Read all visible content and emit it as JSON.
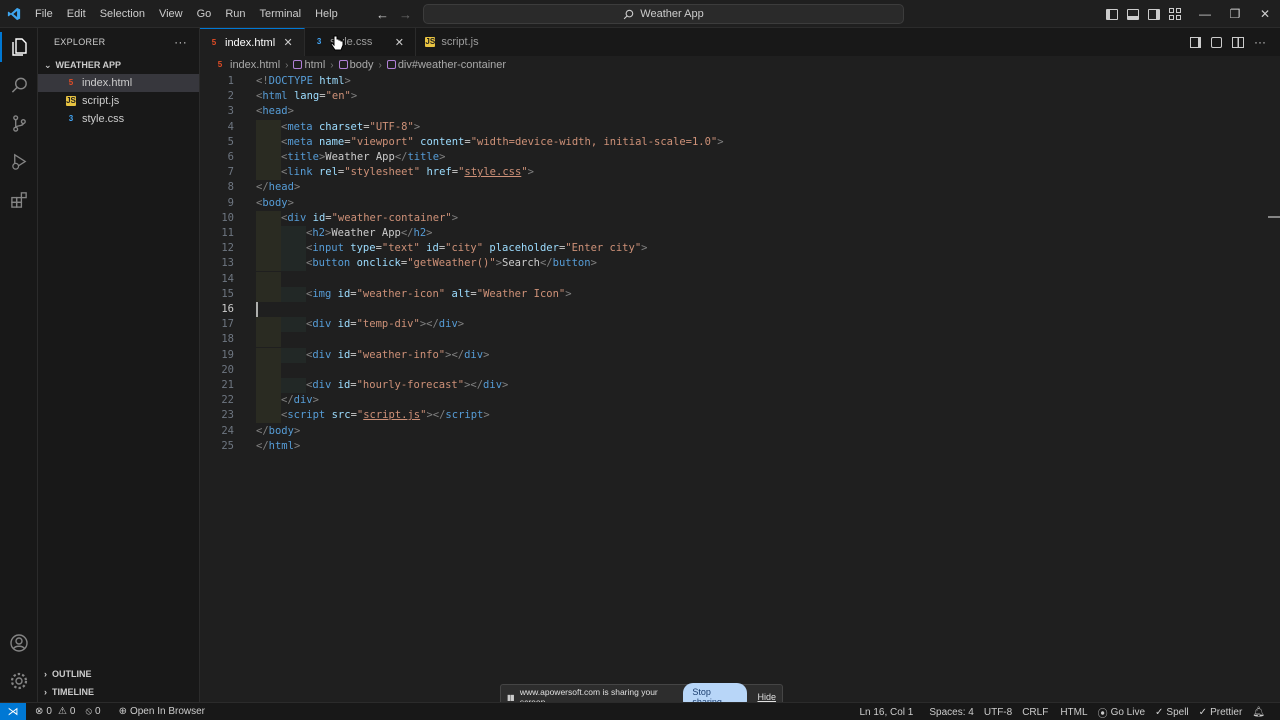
{
  "titlebar": {
    "menus": [
      "File",
      "Edit",
      "Selection",
      "View",
      "Go",
      "Run",
      "Terminal",
      "Help"
    ],
    "search_text": "Weather App",
    "controls": {
      "minimize": "—",
      "maximize": "❐",
      "close": "✕"
    }
  },
  "sidebar": {
    "header": "EXPLORER",
    "more": "···",
    "folder": "WEATHER APP",
    "files": [
      {
        "name": "index.html",
        "type": "html",
        "selected": true
      },
      {
        "name": "script.js",
        "type": "js",
        "selected": false
      },
      {
        "name": "style.css",
        "type": "css",
        "selected": false
      }
    ],
    "outline": "OUTLINE",
    "timeline": "TIMELINE"
  },
  "tabs": [
    {
      "label": "index.html",
      "type": "html",
      "active": true
    },
    {
      "label": "style.css",
      "type": "css",
      "active": false
    },
    {
      "label": "script.js",
      "type": "js",
      "active": false
    }
  ],
  "breadcrumb": {
    "file": "index.html",
    "items": [
      "html",
      "body",
      "div#weather-container"
    ]
  },
  "editor": {
    "current_line": 16,
    "lines": [
      {
        "n": "1",
        "tokens": [
          [
            "c-bracket",
            "<!"
          ],
          [
            "c-tag",
            "DOCTYPE"
          ],
          [
            "c-text",
            " "
          ],
          [
            "c-attr",
            "html"
          ],
          [
            "c-bracket",
            ">"
          ]
        ]
      },
      {
        "n": "2",
        "tokens": [
          [
            "c-bracket",
            "<"
          ],
          [
            "c-tag",
            "html"
          ],
          [
            "c-text",
            " "
          ],
          [
            "c-attr",
            "lang"
          ],
          [
            "c-text",
            "="
          ],
          [
            "c-str",
            "\"en\""
          ],
          [
            "c-bracket",
            ">"
          ]
        ]
      },
      {
        "n": "3",
        "tokens": [
          [
            "c-bracket",
            "<"
          ],
          [
            "c-tag",
            "head"
          ],
          [
            "c-bracket",
            ">"
          ]
        ]
      },
      {
        "n": "4",
        "indent": 1,
        "tokens": [
          [
            "c-bracket",
            "<"
          ],
          [
            "c-tag",
            "meta"
          ],
          [
            "c-text",
            " "
          ],
          [
            "c-attr",
            "charset"
          ],
          [
            "c-text",
            "="
          ],
          [
            "c-str",
            "\"UTF-8\""
          ],
          [
            "c-bracket",
            ">"
          ]
        ]
      },
      {
        "n": "5",
        "indent": 1,
        "tokens": [
          [
            "c-bracket",
            "<"
          ],
          [
            "c-tag",
            "meta"
          ],
          [
            "c-text",
            " "
          ],
          [
            "c-attr",
            "name"
          ],
          [
            "c-text",
            "="
          ],
          [
            "c-str",
            "\"viewport\""
          ],
          [
            "c-text",
            " "
          ],
          [
            "c-attr",
            "content"
          ],
          [
            "c-text",
            "="
          ],
          [
            "c-str",
            "\"width=device-width, initial-scale=1.0\""
          ],
          [
            "c-bracket",
            ">"
          ]
        ]
      },
      {
        "n": "6",
        "indent": 1,
        "tokens": [
          [
            "c-bracket",
            "<"
          ],
          [
            "c-tag",
            "title"
          ],
          [
            "c-bracket",
            ">"
          ],
          [
            "c-text",
            "Weather App"
          ],
          [
            "c-bracket",
            "</"
          ],
          [
            "c-tag",
            "title"
          ],
          [
            "c-bracket",
            ">"
          ]
        ]
      },
      {
        "n": "7",
        "indent": 1,
        "tokens": [
          [
            "c-bracket",
            "<"
          ],
          [
            "c-tag",
            "link"
          ],
          [
            "c-text",
            " "
          ],
          [
            "c-attr",
            "rel"
          ],
          [
            "c-text",
            "="
          ],
          [
            "c-str",
            "\"stylesheet\""
          ],
          [
            "c-text",
            " "
          ],
          [
            "c-attr",
            "href"
          ],
          [
            "c-text",
            "="
          ],
          [
            "c-str",
            "\""
          ],
          [
            "c-str c-ul",
            "style.css"
          ],
          [
            "c-str",
            "\""
          ],
          [
            "c-bracket",
            ">"
          ]
        ]
      },
      {
        "n": "8",
        "tokens": [
          [
            "c-bracket",
            "</"
          ],
          [
            "c-tag",
            "head"
          ],
          [
            "c-bracket",
            ">"
          ]
        ]
      },
      {
        "n": "9",
        "tokens": [
          [
            "c-bracket",
            "<"
          ],
          [
            "c-tag",
            "body"
          ],
          [
            "c-bracket",
            ">"
          ]
        ]
      },
      {
        "n": "10",
        "indent": 1,
        "tokens": [
          [
            "c-bracket",
            "<"
          ],
          [
            "c-tag",
            "div"
          ],
          [
            "c-text",
            " "
          ],
          [
            "c-attr",
            "id"
          ],
          [
            "c-text",
            "="
          ],
          [
            "c-str",
            "\"weather-container\""
          ],
          [
            "c-bracket",
            ">"
          ]
        ]
      },
      {
        "n": "11",
        "indent": 2,
        "tokens": [
          [
            "c-bracket",
            "<"
          ],
          [
            "c-tag",
            "h2"
          ],
          [
            "c-bracket",
            ">"
          ],
          [
            "c-text",
            "Weather App"
          ],
          [
            "c-bracket",
            "</"
          ],
          [
            "c-tag",
            "h2"
          ],
          [
            "c-bracket",
            ">"
          ]
        ]
      },
      {
        "n": "12",
        "indent": 2,
        "tokens": [
          [
            "c-bracket",
            "<"
          ],
          [
            "c-tag",
            "input"
          ],
          [
            "c-text",
            " "
          ],
          [
            "c-attr",
            "type"
          ],
          [
            "c-text",
            "="
          ],
          [
            "c-str",
            "\"text\""
          ],
          [
            "c-text",
            " "
          ],
          [
            "c-attr",
            "id"
          ],
          [
            "c-text",
            "="
          ],
          [
            "c-str",
            "\"city\""
          ],
          [
            "c-text",
            " "
          ],
          [
            "c-attr",
            "placeholder"
          ],
          [
            "c-text",
            "="
          ],
          [
            "c-str",
            "\"Enter city\""
          ],
          [
            "c-bracket",
            ">"
          ]
        ]
      },
      {
        "n": "13",
        "indent": 2,
        "tokens": [
          [
            "c-bracket",
            "<"
          ],
          [
            "c-tag",
            "button"
          ],
          [
            "c-text",
            " "
          ],
          [
            "c-attr",
            "onclick"
          ],
          [
            "c-text",
            "="
          ],
          [
            "c-str",
            "\"getWeather()\""
          ],
          [
            "c-bracket",
            ">"
          ],
          [
            "c-text",
            "Search"
          ],
          [
            "c-bracket",
            "</"
          ],
          [
            "c-tag",
            "button"
          ],
          [
            "c-bracket",
            ">"
          ]
        ]
      },
      {
        "n": "14",
        "indent": 1,
        "tokens": []
      },
      {
        "n": "15",
        "indent": 2,
        "tokens": [
          [
            "c-bracket",
            "<"
          ],
          [
            "c-tag",
            "img"
          ],
          [
            "c-text",
            " "
          ],
          [
            "c-attr",
            "id"
          ],
          [
            "c-text",
            "="
          ],
          [
            "c-str",
            "\"weather-icon\""
          ],
          [
            "c-text",
            " "
          ],
          [
            "c-attr",
            "alt"
          ],
          [
            "c-text",
            "="
          ],
          [
            "c-str",
            "\"Weather Icon\""
          ],
          [
            "c-bracket",
            ">"
          ]
        ]
      },
      {
        "n": "16",
        "tokens": []
      },
      {
        "n": "17",
        "indent": 2,
        "tokens": [
          [
            "c-bracket",
            "<"
          ],
          [
            "c-tag",
            "div"
          ],
          [
            "c-text",
            " "
          ],
          [
            "c-attr",
            "id"
          ],
          [
            "c-text",
            "="
          ],
          [
            "c-str",
            "\"temp-div\""
          ],
          [
            "c-bracket",
            "></"
          ],
          [
            "c-tag",
            "div"
          ],
          [
            "c-bracket",
            ">"
          ]
        ]
      },
      {
        "n": "18",
        "indent": 1,
        "tokens": []
      },
      {
        "n": "19",
        "indent": 2,
        "tokens": [
          [
            "c-bracket",
            "<"
          ],
          [
            "c-tag",
            "div"
          ],
          [
            "c-text",
            " "
          ],
          [
            "c-attr",
            "id"
          ],
          [
            "c-text",
            "="
          ],
          [
            "c-str",
            "\"weather-info\""
          ],
          [
            "c-bracket",
            "></"
          ],
          [
            "c-tag",
            "div"
          ],
          [
            "c-bracket",
            ">"
          ]
        ]
      },
      {
        "n": "20",
        "indent": 1,
        "tokens": []
      },
      {
        "n": "21",
        "indent": 2,
        "tokens": [
          [
            "c-bracket",
            "<"
          ],
          [
            "c-tag",
            "div"
          ],
          [
            "c-text",
            " "
          ],
          [
            "c-attr",
            "id"
          ],
          [
            "c-text",
            "="
          ],
          [
            "c-str",
            "\"hourly-forecast\""
          ],
          [
            "c-bracket",
            "></"
          ],
          [
            "c-tag",
            "div"
          ],
          [
            "c-bracket",
            ">"
          ]
        ]
      },
      {
        "n": "22",
        "indent": 1,
        "tokens": [
          [
            "c-bracket",
            "</"
          ],
          [
            "c-tag",
            "div"
          ],
          [
            "c-bracket",
            ">"
          ]
        ]
      },
      {
        "n": "23",
        "indent": 1,
        "tokens": [
          [
            "c-bracket",
            "<"
          ],
          [
            "c-tag",
            "script"
          ],
          [
            "c-text",
            " "
          ],
          [
            "c-attr",
            "src"
          ],
          [
            "c-text",
            "="
          ],
          [
            "c-str",
            "\""
          ],
          [
            "c-str c-ul",
            "script.js"
          ],
          [
            "c-str",
            "\""
          ],
          [
            "c-bracket",
            "></"
          ],
          [
            "c-tag",
            "script"
          ],
          [
            "c-bracket",
            ">"
          ]
        ]
      },
      {
        "n": "24",
        "tokens": [
          [
            "c-bracket",
            "</"
          ],
          [
            "c-tag",
            "body"
          ],
          [
            "c-bracket",
            ">"
          ]
        ]
      },
      {
        "n": "25",
        "tokens": [
          [
            "c-bracket",
            "</"
          ],
          [
            "c-tag",
            "html"
          ],
          [
            "c-bracket",
            ">"
          ]
        ]
      }
    ]
  },
  "statusbar": {
    "errors": "0",
    "warnings": "0",
    "ports": "0",
    "open_in_browser": "Open In Browser",
    "position": "Ln 16, Col 1",
    "spaces": "Spaces: 4",
    "encoding": "UTF-8",
    "eol": "CRLF",
    "language": "HTML",
    "go_live": "Go Live",
    "spell": "Spell",
    "prettier": "Prettier"
  },
  "share_banner": {
    "message": "www.apowersoft.com is sharing your screen.",
    "stop_label": "Stop sharing",
    "hide_label": "Hide"
  },
  "colors": {
    "accent": "#0078d4",
    "editor_bg": "#1f1f1f",
    "sidebar_bg": "#181818",
    "tag": "#569cd6",
    "attr": "#9cdcfe",
    "string": "#ce9178"
  }
}
